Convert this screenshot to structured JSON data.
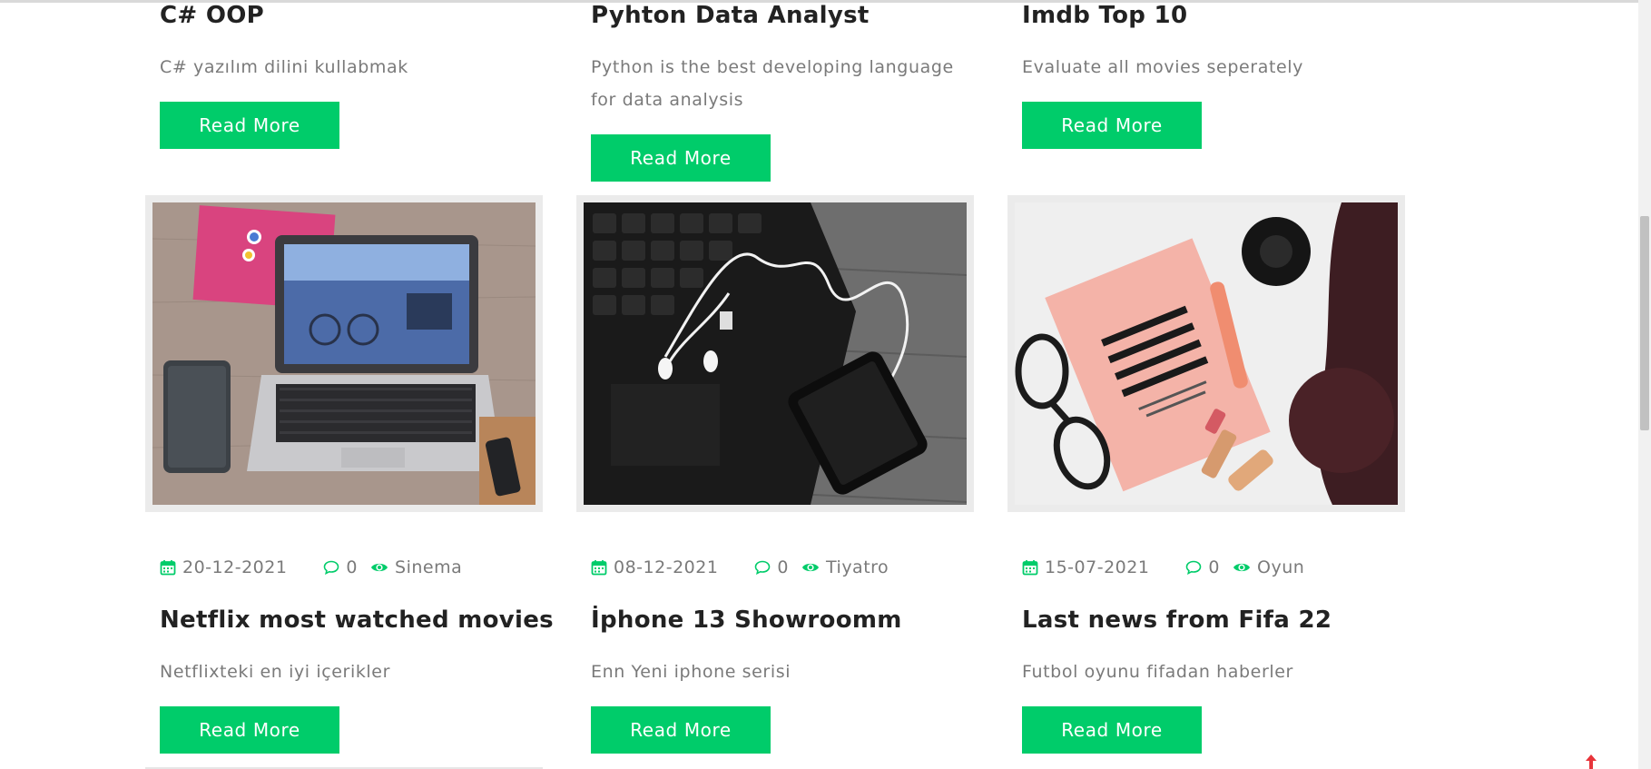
{
  "top_row": [
    {
      "title": "C# OOP",
      "description": "C# yazılım dilini kullabmak",
      "button": "Read More"
    },
    {
      "title": "Pyhton Data Analyst",
      "description": "Python is the best developing language for data analysis",
      "button": "Read More"
    },
    {
      "title": "Imdb Top 10",
      "description": "Evaluate all movies seperately",
      "button": "Read More"
    }
  ],
  "bottom_row": [
    {
      "image": "laptop-desk-photo",
      "date": "20-12-2021",
      "comments": "0",
      "category": "Sinema",
      "title": "Netflix most watched movies",
      "description": "Netflixteki en iyi içerikler",
      "button": "Read More"
    },
    {
      "image": "keyboard-earphones-phone-photo",
      "date": "08-12-2021",
      "comments": "0",
      "category": "Tiyatro",
      "title": "İphone 13 Showroomm",
      "description": "Enn Yeni iphone serisi",
      "button": "Read More"
    },
    {
      "image": "little-black-book-photo",
      "date": "15-07-2021",
      "comments": "0",
      "category": "Oyun",
      "title": "Last news from Fifa 22",
      "description": "Futbol oyunu fifadan haberler",
      "button": "Read More"
    }
  ],
  "icons": {
    "date": "calendar-icon",
    "comments": "comment-icon",
    "category": "eye-icon",
    "scroll_top": "arrow-up-icon"
  },
  "colors": {
    "accent": "#00cc6a",
    "title": "#222222",
    "text": "#7a7a7a",
    "image_frame": "#ebebeb"
  }
}
